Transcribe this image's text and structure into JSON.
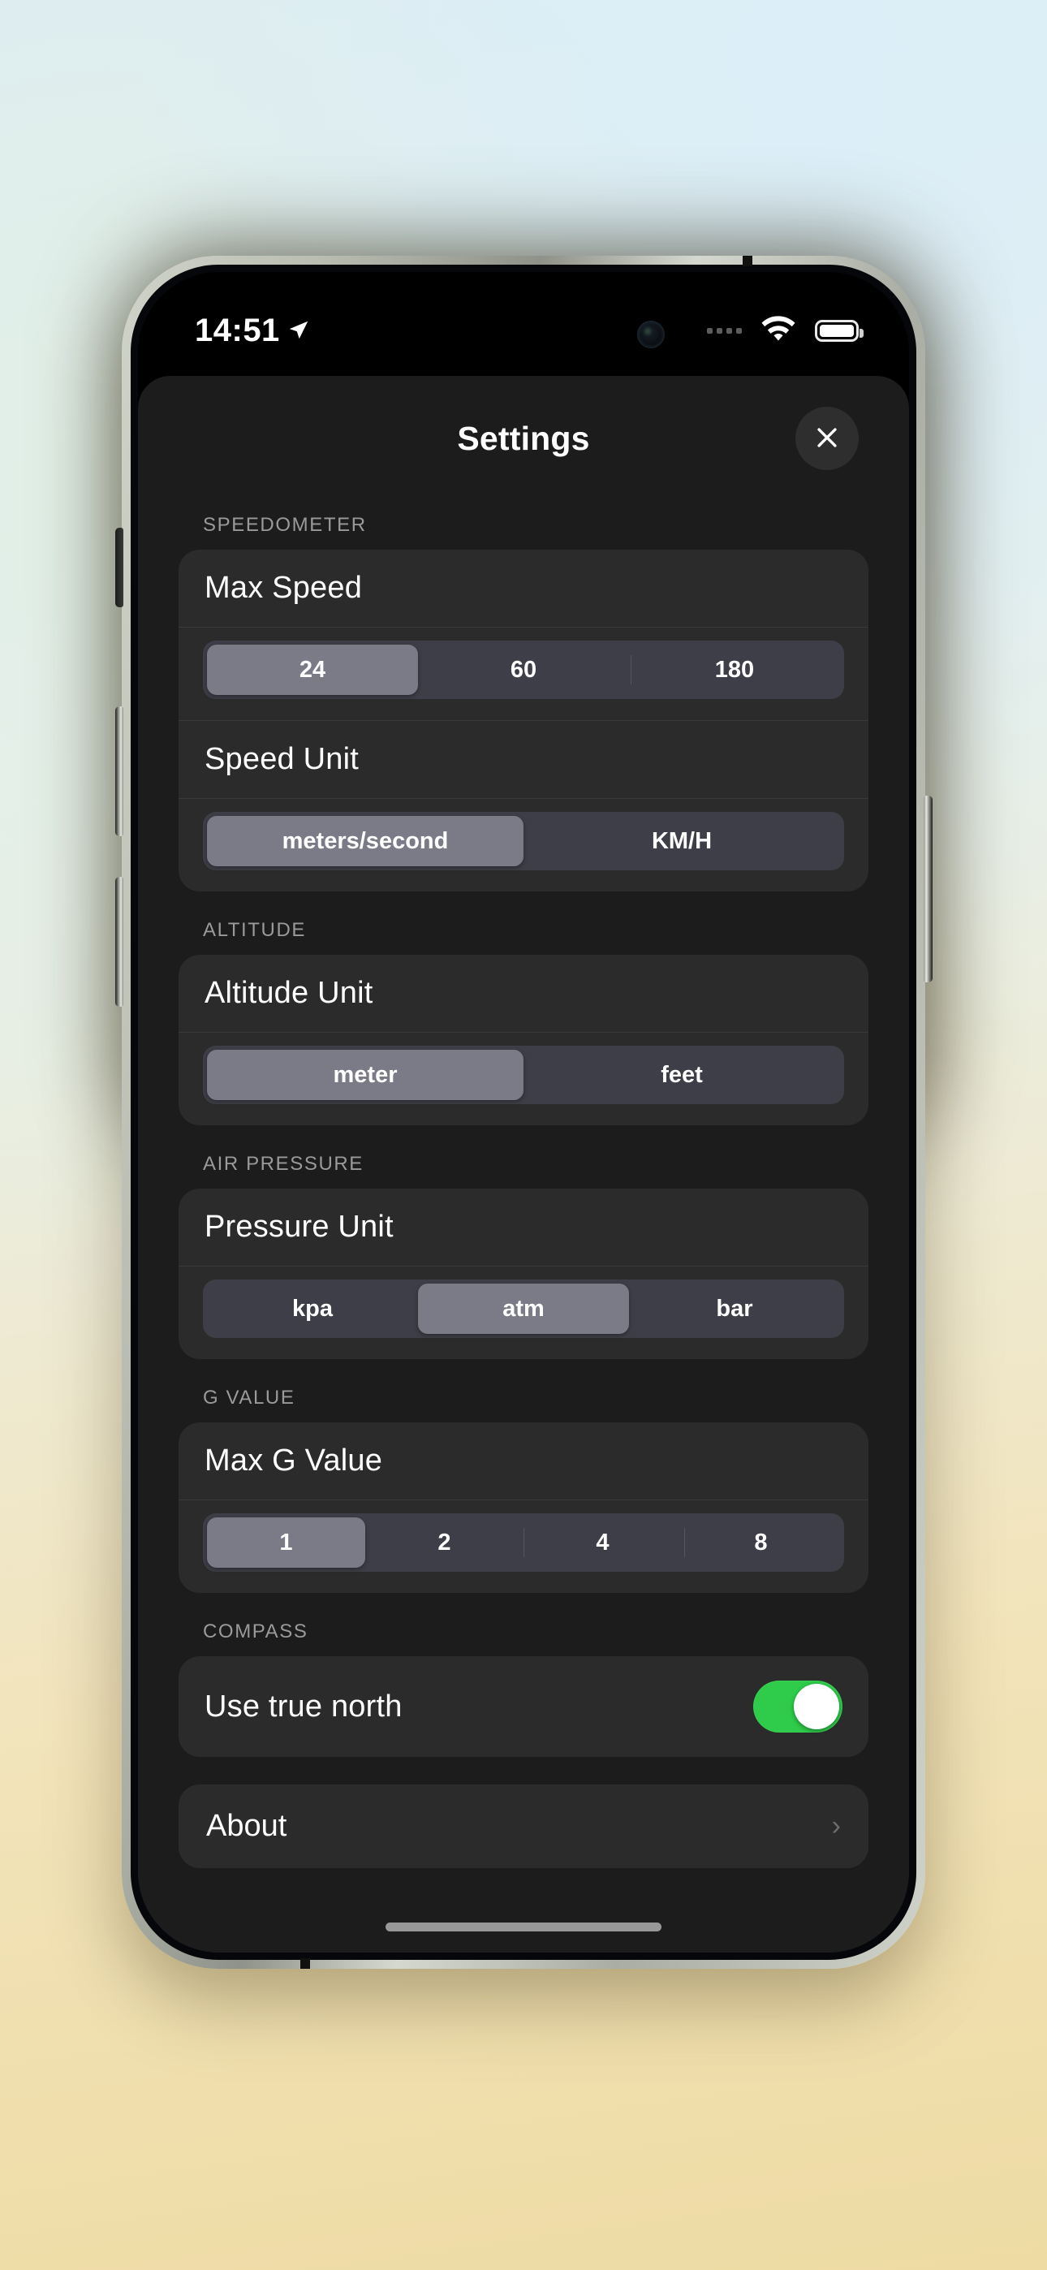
{
  "status_bar": {
    "time": "14:51",
    "location_icon": "location-arrow-icon",
    "camera_icon": "front-camera-icon",
    "signal_icon": "cellular-dots-icon",
    "wifi_icon": "wifi-icon",
    "battery_icon": "battery-full-icon"
  },
  "sheet": {
    "title": "Settings",
    "close_icon": "close-x-icon"
  },
  "sections": [
    {
      "label": "SPEEDOMETER",
      "rows": [
        {
          "title": "Max Speed",
          "options": [
            "24",
            "60",
            "180"
          ],
          "selected_index": 0
        },
        {
          "title": "Speed Unit",
          "options": [
            "meters/second",
            "KM/H"
          ],
          "selected_index": 0
        }
      ]
    },
    {
      "label": "ALTITUDE",
      "rows": [
        {
          "title": "Altitude Unit",
          "options": [
            "meter",
            "feet"
          ],
          "selected_index": 0
        }
      ]
    },
    {
      "label": "AIR PRESSURE",
      "rows": [
        {
          "title": "Pressure Unit",
          "options": [
            "kpa",
            "atm",
            "bar"
          ],
          "selected_index": 1
        }
      ]
    },
    {
      "label": "G VALUE",
      "rows": [
        {
          "title": "Max G Value",
          "options": [
            "1",
            "2",
            "4",
            "8"
          ],
          "selected_index": 0
        }
      ]
    },
    {
      "label": "COMPASS",
      "rows": [
        {
          "title": "Use true north",
          "toggle": true,
          "toggle_on": true
        }
      ]
    }
  ],
  "about": {
    "label": "About",
    "chevron_icon": "chevron-right-icon"
  },
  "colors": {
    "sheet_bg": "#1c1c1c",
    "card_bg": "#2b2b2b",
    "segment_track": "#3e3e48",
    "segment_selected": "#7b7b88",
    "toggle_on": "#2ecc4a",
    "section_label": "#9a9a9a",
    "text_primary": "#ffffff"
  }
}
